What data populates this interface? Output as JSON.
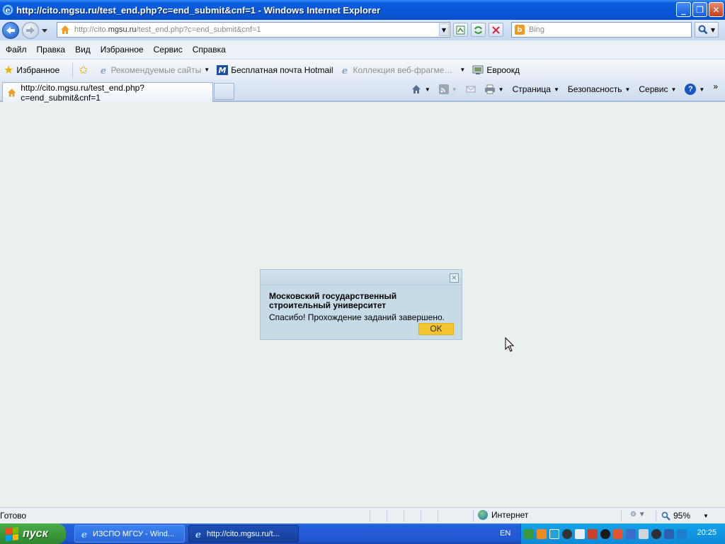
{
  "window": {
    "title": "http://cito.mgsu.ru/test_end.php?c=end_submit&cnf=1 - Windows Internet Explorer"
  },
  "address": {
    "url_prefix": "http://cito.",
    "url_domain": "mgsu.ru",
    "url_rest": "/test_end.php?c=end_submit&cnf=1"
  },
  "search": {
    "placeholder": "Bing"
  },
  "menu": {
    "items": [
      "Файл",
      "Правка",
      "Вид",
      "Избранное",
      "Сервис",
      "Справка"
    ]
  },
  "favorites_bar": {
    "favorites_label": "Избранное",
    "items": [
      {
        "label": "Рекомендуемые сайты",
        "icon": "ie-icon",
        "disabled": true
      },
      {
        "label": "Бесплатная почта Hotmail",
        "icon": "hotmail-icon",
        "disabled": false
      },
      {
        "label": "Коллекция веб-фрагме…",
        "icon": "ie-icon",
        "disabled": true
      },
      {
        "label": "Евроокд",
        "icon": "web-icon",
        "disabled": false
      }
    ]
  },
  "tab": {
    "label": "http://cito.mgsu.ru/test_end.php?c=end_submit&cnf=1"
  },
  "command_bar": {
    "page_label": "Страница",
    "safety_label": "Безопасность",
    "tools_label": "Сервис"
  },
  "dialog": {
    "title": "Московский государственный строительный университет",
    "message": "Спасибо! Прохождение заданий завершено.",
    "ok_label": "OK",
    "close_label": "×"
  },
  "status": {
    "text": "Готово",
    "zone": "Интернет",
    "zoom": "95%"
  },
  "taskbar": {
    "start_label": "пуск",
    "tasks": [
      {
        "label": "ИЗСПО МГСУ - Wind..."
      },
      {
        "label": "http://cito.mgsu.ru/t..."
      }
    ],
    "lang": "EN",
    "clock": "20:25"
  }
}
